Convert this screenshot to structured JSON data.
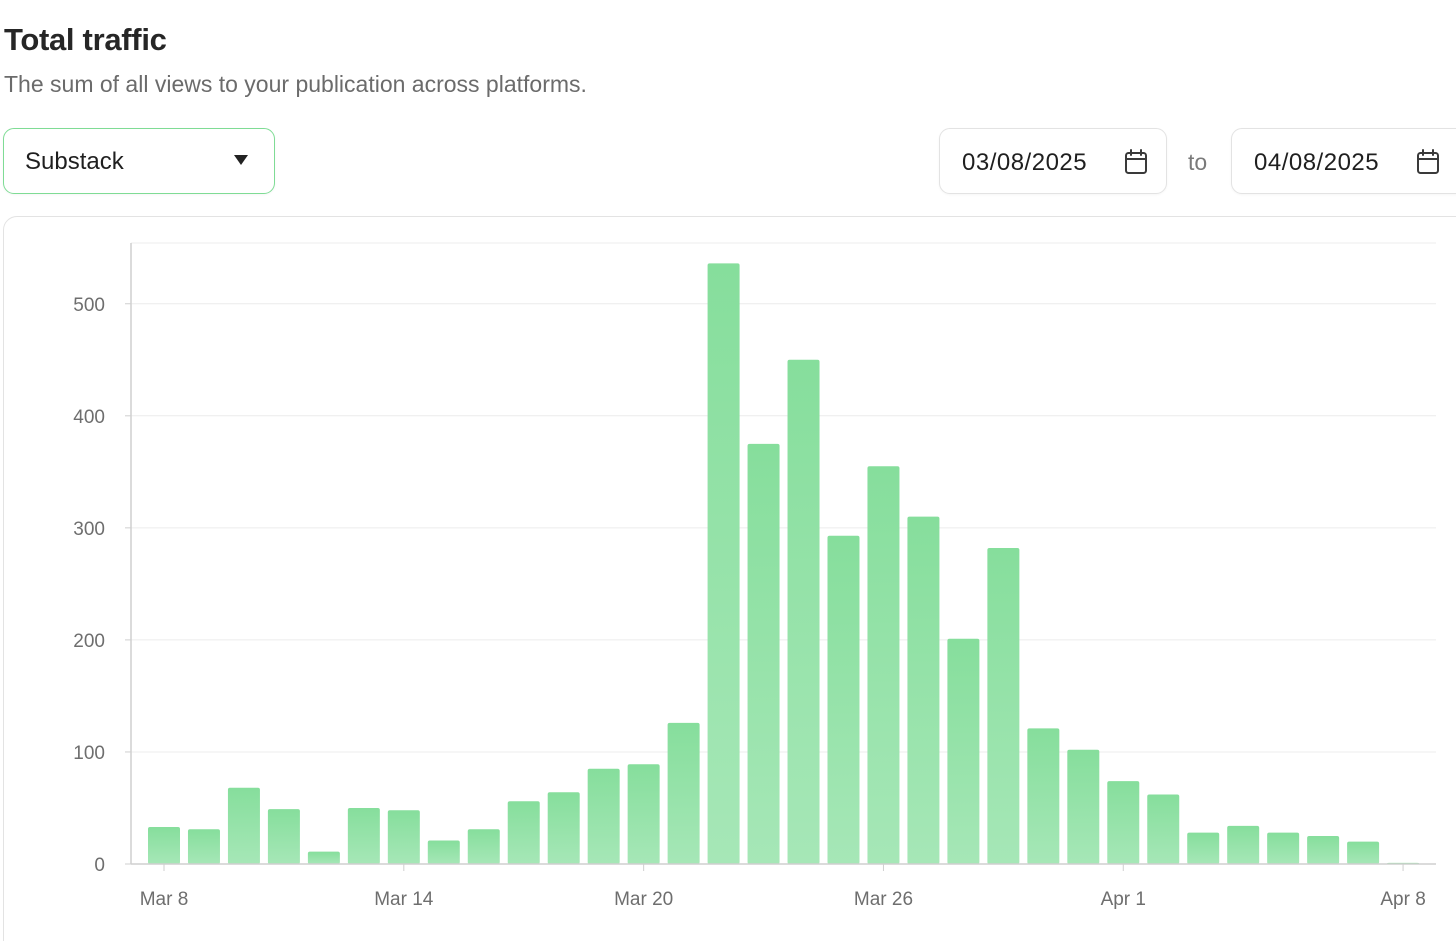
{
  "header": {
    "title": "Total traffic",
    "subtitle": "The sum of all views to your publication across platforms."
  },
  "filters": {
    "platform_selected": "Substack",
    "date_from": "03/08/2025",
    "date_to": "04/08/2025",
    "to_label": "to"
  },
  "icons": {
    "select_caret": "caret-down-icon",
    "date_picker": "calendar-icon"
  },
  "colors": {
    "bar_top": "#86de9c",
    "bar_bottom": "#a6e7b7",
    "select_border": "#7fdc95",
    "grid": "#ececec",
    "axis": "#cfcfcf"
  },
  "chart_data": {
    "type": "bar",
    "title": "",
    "xlabel": "",
    "ylabel": "",
    "ylim": [
      0,
      550
    ],
    "yticks": [
      0,
      100,
      200,
      300,
      400,
      500
    ],
    "grid": true,
    "legend": "none",
    "x": [
      "2025-03-08",
      "2025-03-09",
      "2025-03-10",
      "2025-03-11",
      "2025-03-12",
      "2025-03-13",
      "2025-03-14",
      "2025-03-15",
      "2025-03-16",
      "2025-03-17",
      "2025-03-18",
      "2025-03-19",
      "2025-03-20",
      "2025-03-21",
      "2025-03-22",
      "2025-03-23",
      "2025-03-24",
      "2025-03-25",
      "2025-03-26",
      "2025-03-27",
      "2025-03-28",
      "2025-03-29",
      "2025-03-30",
      "2025-03-31",
      "2025-04-01",
      "2025-04-02",
      "2025-04-03",
      "2025-04-04",
      "2025-04-05",
      "2025-04-06",
      "2025-04-07",
      "2025-04-08"
    ],
    "x_tick_labels": [
      {
        "date": "2025-03-08",
        "label": "Mar 8"
      },
      {
        "date": "2025-03-14",
        "label": "Mar 14"
      },
      {
        "date": "2025-03-20",
        "label": "Mar 20"
      },
      {
        "date": "2025-03-26",
        "label": "Mar 26"
      },
      {
        "date": "2025-04-01",
        "label": "Apr 1"
      },
      {
        "date": "2025-04-08",
        "label": "Apr 8"
      }
    ],
    "values": [
      33,
      31,
      68,
      49,
      11,
      50,
      48,
      21,
      31,
      56,
      64,
      85,
      89,
      126,
      536,
      375,
      450,
      293,
      355,
      310,
      201,
      282,
      121,
      102,
      74,
      62,
      28,
      34,
      28,
      25,
      20,
      1
    ]
  }
}
